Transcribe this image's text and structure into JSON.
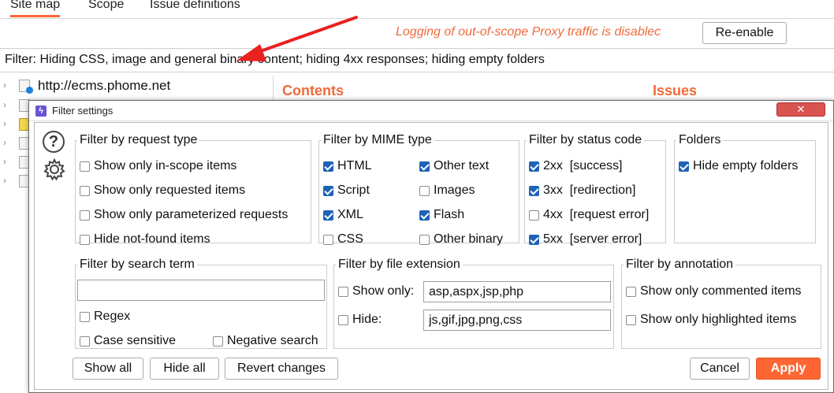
{
  "tabs": [
    "Site map",
    "Scope",
    "Issue definitions"
  ],
  "scope_notice": "Logging of out-of-scope Proxy traffic is disablec",
  "reenable_label": "Re-enable",
  "filter_bar": "Filter: Hiding CSS, image and general binary content;  hiding 4xx responses;  hiding empty folders",
  "tree": {
    "first_host": "http://ecms.phome.net"
  },
  "panels": {
    "contents": "Contents",
    "issues": "Issues"
  },
  "dialog": {
    "title": "Filter settings",
    "close_icon": "✕",
    "request_type": {
      "legend": "Filter by request type",
      "items": [
        {
          "label": "Show only in-scope items",
          "checked": false
        },
        {
          "label": "Show only requested items",
          "checked": false
        },
        {
          "label": "Show only parameterized requests",
          "checked": false
        },
        {
          "label": "Hide not-found items",
          "checked": false
        }
      ]
    },
    "mime_type": {
      "legend": "Filter by MIME type",
      "items": [
        {
          "label": "HTML",
          "checked": true
        },
        {
          "label": "Other text",
          "checked": true
        },
        {
          "label": "Script",
          "checked": true
        },
        {
          "label": "Images",
          "checked": false
        },
        {
          "label": "XML",
          "checked": true
        },
        {
          "label": "Flash",
          "checked": true
        },
        {
          "label": "CSS",
          "checked": false
        },
        {
          "label": "Other binary",
          "checked": false
        }
      ]
    },
    "status_code": {
      "legend": "Filter by status code",
      "items": [
        {
          "label": "2xx  [success]",
          "checked": true
        },
        {
          "label": "3xx  [redirection]",
          "checked": true
        },
        {
          "label": "4xx  [request error]",
          "checked": false
        },
        {
          "label": "5xx  [server error]",
          "checked": true
        }
      ]
    },
    "folders": {
      "legend": "Folders",
      "items": [
        {
          "label": "Hide empty folders",
          "checked": true
        }
      ]
    },
    "search_term": {
      "legend": "Filter by search term",
      "value": "",
      "regex": "Regex",
      "case_sensitive": "Case sensitive",
      "negative": "Negative search"
    },
    "file_extension": {
      "legend": "Filter by file extension",
      "show_only_label": "Show only:",
      "show_only_value": "asp,aspx,jsp,php",
      "hide_label": "Hide:",
      "hide_value": "js,gif,jpg,png,css"
    },
    "annotation": {
      "legend": "Filter by annotation",
      "commented": "Show only commented items",
      "highlighted": "Show only highlighted items"
    },
    "buttons": {
      "show_all": "Show all",
      "hide_all": "Hide all",
      "revert": "Revert changes",
      "cancel": "Cancel",
      "apply": "Apply"
    }
  },
  "colors": {
    "accent": "#ff6633",
    "checkbox_on": "#1e63b5",
    "notice": "#f06a3a"
  }
}
